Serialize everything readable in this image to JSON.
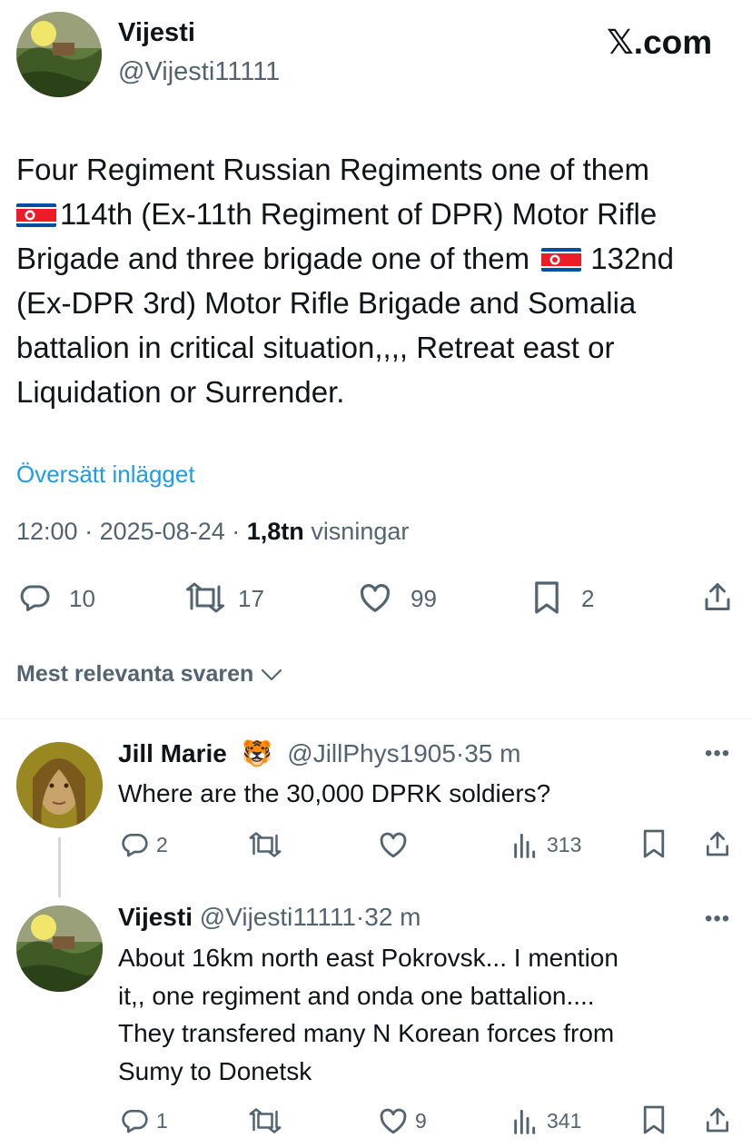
{
  "brand": {
    "logo_text": "𝕏.com"
  },
  "post": {
    "author_name": "Vijesti",
    "author_handle": "@Vijesti11111",
    "text_parts": [
      "Four Regiment  Russian Regiments one of them",
      "114th (Ex-11th Regiment of DPR) Motor Rifle",
      "Brigade and three brigade one of them",
      "132nd",
      "(Ex-DPR 3rd) Motor Rifle Brigade and Somalia",
      "battalion in critical situation,,,, Retreat east or",
      "Liquidation or Surrender."
    ],
    "translate_label": "Översätt inlägget",
    "time": "12:00",
    "date": "2025-08-24",
    "views_count": "1,8tn",
    "views_label": "visningar",
    "separator": "·",
    "stats": {
      "replies": "10",
      "reposts": "17",
      "likes": "99",
      "bookmarks": "2"
    }
  },
  "sort": {
    "label": "Mest relevanta svaren"
  },
  "replies": [
    {
      "author_name": "Jill Marie",
      "emoji": "🐯",
      "author_handle": "@JillPhys1905",
      "separator": "·",
      "time": "35 m",
      "lines": [
        "Where are the 30,000 DPRK soldiers?"
      ],
      "stats": {
        "replies": "2",
        "views": "313"
      }
    },
    {
      "author_name": "Vijesti",
      "author_handle": "@Vijesti11111",
      "separator": "·",
      "time": "32 m",
      "lines": [
        "About 16km north east Pokrovsk... I mention",
        "it,, one regiment and onda one battalion....",
        "They transfered many N Korean forces from",
        "Sumy to Donetsk"
      ],
      "stats": {
        "replies": "1",
        "likes": "9",
        "views": "341"
      }
    }
  ],
  "menu_glyph": "•••",
  "colors": {
    "link": "#1d9bf0",
    "text": "#0f1419",
    "secondary": "#536471",
    "divider": "#eff3f4"
  },
  "icons": [
    "reply-icon",
    "repost-icon",
    "like-icon",
    "bookmark-icon",
    "share-icon",
    "views-icon",
    "chevron-down-icon",
    "more-icon",
    "north-korea-flag-icon"
  ]
}
